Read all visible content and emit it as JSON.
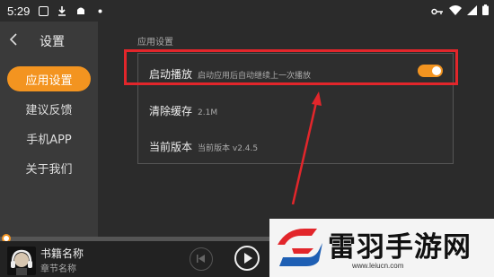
{
  "status_bar": {
    "time": "5:29",
    "icons_left": [
      "photo-icon",
      "download-icon",
      "android-icon",
      "dot-icon"
    ],
    "icons_right": [
      "key-icon",
      "wifi-icon",
      "signal-icon",
      "battery-icon"
    ]
  },
  "header": {
    "title": "设置",
    "back_icon": "chevron-left-icon"
  },
  "sidebar": {
    "items": [
      {
        "label": "应用设置",
        "active": true
      },
      {
        "label": "建议反馈",
        "active": false
      },
      {
        "label": "手机APP",
        "active": false
      },
      {
        "label": "关于我们",
        "active": false
      }
    ]
  },
  "main": {
    "section_label": "应用设置",
    "rows": [
      {
        "label": "启动播放",
        "sub": "启动应用后自动继续上一次播放",
        "toggle_on": true
      },
      {
        "label": "清除缓存",
        "sub": "2.1M"
      },
      {
        "label": "当前版本",
        "sub": "当前版本 v2.4.5"
      }
    ]
  },
  "player": {
    "book_name": "书籍名称",
    "chapter_name": "章节名称",
    "progress": 0.0
  },
  "watermark": {
    "title": "雷羽手游网",
    "url": "www.leiucn.com"
  },
  "colors": {
    "accent": "#f39420",
    "highlight_box": "#e2262b",
    "background": "#2b2b2b",
    "sidebar": "#3a3a3a"
  }
}
